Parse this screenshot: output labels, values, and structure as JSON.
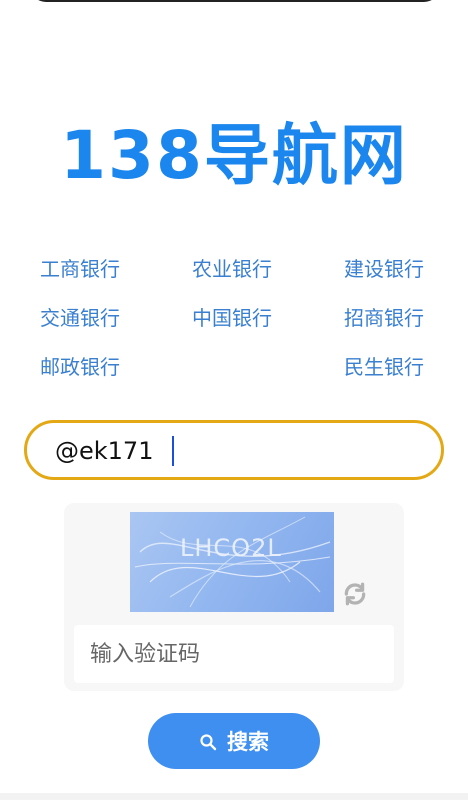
{
  "logo": {
    "text": "138导航网"
  },
  "banks": [
    {
      "label": "工商银行"
    },
    {
      "label": "农业银行"
    },
    {
      "label": "建设银行"
    },
    {
      "label": "交通银行"
    },
    {
      "label": "中国银行"
    },
    {
      "label": "招商银行"
    },
    {
      "label": "邮政银行"
    },
    {
      "label": "民生银行"
    }
  ],
  "search": {
    "value": "@ek171"
  },
  "captcha": {
    "image_text": "LHCO2L",
    "input_placeholder": "输入验证码",
    "refresh_icon": "refresh-icon"
  },
  "search_button": {
    "label": "搜索",
    "icon": "search-icon"
  },
  "colors": {
    "brand": "#1a86ee",
    "link": "#3a7fd0",
    "search_border": "#e3a814",
    "button": "#3f8ff0"
  }
}
